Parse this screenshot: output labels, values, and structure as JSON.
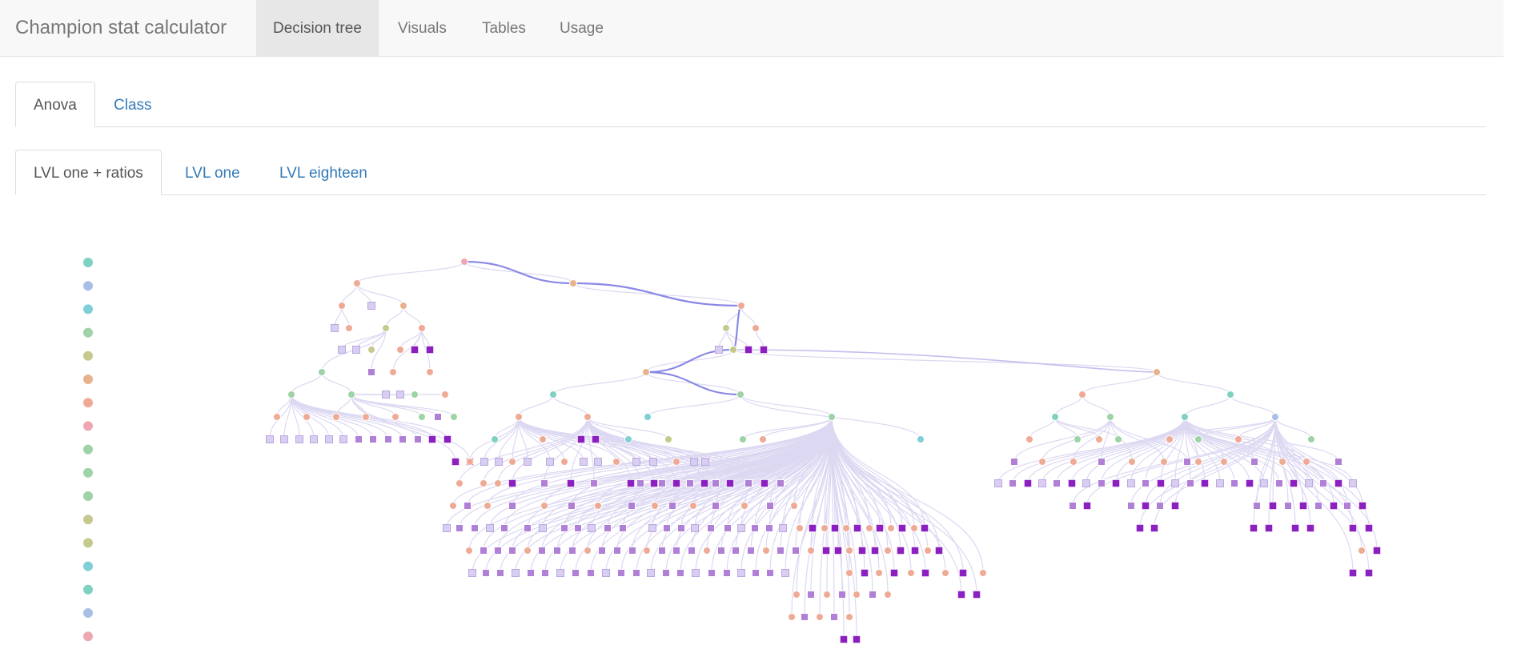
{
  "navbar": {
    "brand": "Champion stat calculator",
    "items": [
      {
        "label": "Decision tree",
        "active": true
      },
      {
        "label": "Visuals",
        "active": false
      },
      {
        "label": "Tables",
        "active": false
      },
      {
        "label": "Usage",
        "active": false
      }
    ]
  },
  "model_tabs": [
    {
      "label": "Anova",
      "active": true
    },
    {
      "label": "Class",
      "active": false
    }
  ],
  "level_tabs": [
    {
      "label": "LVL one + ratios",
      "active": true
    },
    {
      "label": "LVL one",
      "active": false
    },
    {
      "label": "LVL eighteen",
      "active": false
    }
  ],
  "colors": {
    "split_teal": "#7fd1c1",
    "split_blue": "#a9bfe8",
    "split_cyan": "#7fcfd6",
    "split_green": "#9dd3a6",
    "split_olive": "#c5c98d",
    "split_orange": "#e8b38c",
    "split_salmon": "#eeaa95",
    "split_pink": "#eea7b0",
    "leaf_light": "#d9cdf2",
    "leaf_mid": "#b07fd6",
    "leaf_dark": "#8b1fbf",
    "edge": "#dcd8f2",
    "highlight_path": "#8a8ae6"
  },
  "legend": {
    "swatches": [
      "split_teal",
      "split_blue",
      "split_cyan",
      "split_green",
      "split_olive",
      "split_orange",
      "split_salmon",
      "split_pink",
      "split_green",
      "split_green",
      "split_green",
      "split_olive",
      "split_olive",
      "split_cyan",
      "split_teal",
      "split_blue",
      "split_pink"
    ]
  }
}
